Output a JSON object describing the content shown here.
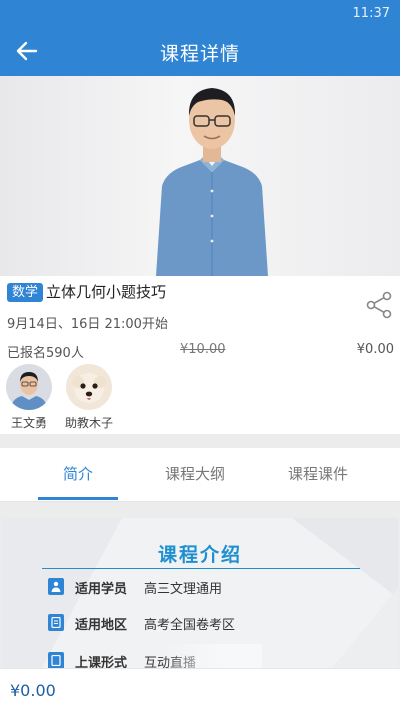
{
  "status_bar": {
    "time": "11:37"
  },
  "app_bar": {
    "title": "课程详情",
    "back_icon": "arrow-left-icon"
  },
  "course": {
    "subject_tag": "数学",
    "title": "立体几何小题技巧",
    "schedule": "9月14日、16日 21:00开始",
    "enrolled": "已报名590人",
    "original_price": "¥10.00",
    "price": "¥0.00",
    "share_icon": "share-icon"
  },
  "teachers": [
    {
      "name": "王文勇"
    },
    {
      "name": "助教木子"
    }
  ],
  "tabs": [
    {
      "label": "简介",
      "active": true
    },
    {
      "label": "课程大纲",
      "active": false
    },
    {
      "label": "课程课件",
      "active": false
    }
  ],
  "intro": {
    "title": "课程介绍",
    "rows": [
      {
        "key": "适用学员",
        "value": "高三文理通用"
      },
      {
        "key": "适用地区",
        "value": "高考全国卷考区"
      },
      {
        "key": "上课形式",
        "value": "互动直播"
      }
    ]
  },
  "bottom_bar": {
    "amount": "¥0.00"
  },
  "colors": {
    "primary": "#2f84d4",
    "intro_title": "#1f8fd0"
  }
}
